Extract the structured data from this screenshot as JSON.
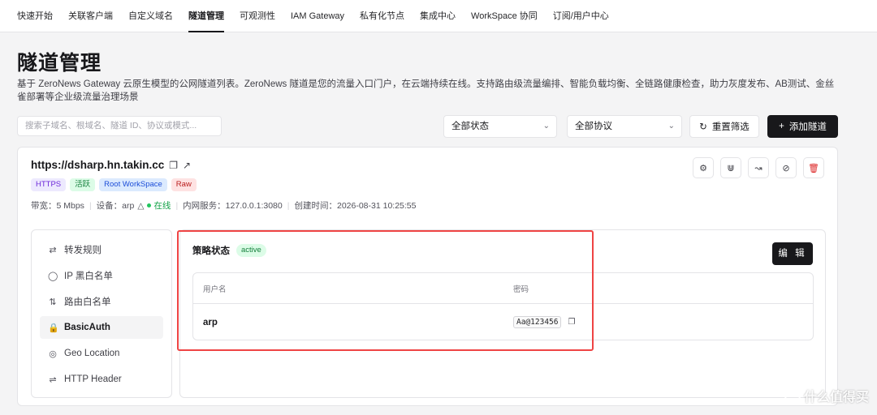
{
  "nav": {
    "tabs": [
      "快速开始",
      "关联客户端",
      "自定义域名",
      "隧道管理",
      "可观测性",
      "IAM Gateway",
      "私有化节点",
      "集成中心",
      "WorkSpace 协同",
      "订阅/用户中心"
    ],
    "active_index": 3
  },
  "page": {
    "title": "隧道管理",
    "description": "基于 ZeroNews Gateway 云原生模型的公网隧道列表。ZeroNews 隧道是您的流量入口门户，在云端持续在线。支持路由级流量编排、智能负载均衡、全链路健康检查，助力灰度发布、AB测试、金丝雀部署等企业级流量治理场景"
  },
  "filters": {
    "search_placeholder": "搜索子域名、根域名、隧道 ID、协议或模式...",
    "status_select": "全部状态",
    "protocol_select": "全部协议",
    "reset_label": "重置筛选",
    "add_label": "添加隧道"
  },
  "tunnel": {
    "url": "https://dsharp.hn.takin.cc",
    "badges": [
      "HTTPS",
      "活跃",
      "Root WorkSpace",
      "Raw"
    ],
    "bandwidth": "带宽：5 Mbps",
    "device_label": "设备：arp",
    "online": "在线",
    "intranet": "内网服务：127.0.0.1:3080",
    "created": "创建时间：2026-08-31 10:25:55"
  },
  "menu": {
    "items": [
      {
        "label": "转发规则",
        "icon": "shuffle-icon"
      },
      {
        "label": "IP 黑白名单",
        "icon": "shield-icon"
      },
      {
        "label": "路由白名单",
        "icon": "route-icon"
      },
      {
        "label": "BasicAuth",
        "icon": "lock-icon"
      },
      {
        "label": "Geo Location",
        "icon": "location-icon"
      },
      {
        "label": "HTTP Header",
        "icon": "arrows-icon"
      }
    ],
    "active_index": 3
  },
  "policy": {
    "title": "策略状态",
    "status": "active",
    "edit_label": "编 辑",
    "columns": [
      "用户名",
      "密码"
    ],
    "rows": [
      {
        "username": "arp",
        "password": "Aa@123456"
      }
    ]
  },
  "watermark": "什么值得买",
  "colors": {
    "primary": "#18181b",
    "highlight": "#ef4444",
    "online": "#22c55e"
  }
}
